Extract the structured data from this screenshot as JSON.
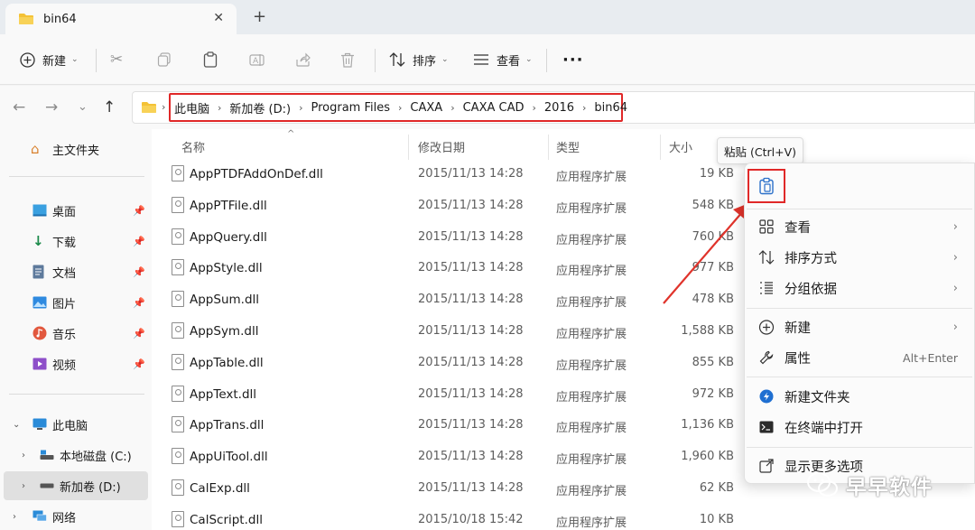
{
  "tab": {
    "title": "bin64",
    "close": "✕",
    "new_tab": "+"
  },
  "toolbar": {
    "new_label": "新建",
    "sort_label": "排序",
    "view_label": "查看",
    "more": "···"
  },
  "address": {
    "crumbs": [
      "此电脑",
      "新加卷 (D:)",
      "Program Files",
      "CAXA",
      "CAXA CAD",
      "2016",
      "bin64"
    ]
  },
  "sidebar": {
    "home": "主文件夹",
    "items": [
      {
        "label": "桌面",
        "icon": "desktop-icon"
      },
      {
        "label": "下载",
        "icon": "download-icon"
      },
      {
        "label": "文档",
        "icon": "document-icon"
      },
      {
        "label": "图片",
        "icon": "picture-icon"
      },
      {
        "label": "音乐",
        "icon": "music-icon"
      },
      {
        "label": "视频",
        "icon": "video-icon"
      }
    ],
    "this_pc": "此电脑",
    "drive_c": "本地磁盘 (C:)",
    "drive_d": "新加卷 (D:)",
    "network": "网络"
  },
  "columns": {
    "name": "名称",
    "date": "修改日期",
    "type": "类型",
    "size": "大小"
  },
  "files": [
    {
      "name": "AppPTDFAddOnDef.dll",
      "date": "2015/11/13 14:28",
      "type": "应用程序扩展",
      "size": "19 KB"
    },
    {
      "name": "AppPTFile.dll",
      "date": "2015/11/13 14:28",
      "type": "应用程序扩展",
      "size": "548 KB"
    },
    {
      "name": "AppQuery.dll",
      "date": "2015/11/13 14:28",
      "type": "应用程序扩展",
      "size": "760 KB"
    },
    {
      "name": "AppStyle.dll",
      "date": "2015/11/13 14:28",
      "type": "应用程序扩展",
      "size": "977 KB"
    },
    {
      "name": "AppSum.dll",
      "date": "2015/11/13 14:28",
      "type": "应用程序扩展",
      "size": "478 KB"
    },
    {
      "name": "AppSym.dll",
      "date": "2015/11/13 14:28",
      "type": "应用程序扩展",
      "size": "1,588 KB"
    },
    {
      "name": "AppTable.dll",
      "date": "2015/11/13 14:28",
      "type": "应用程序扩展",
      "size": "855 KB"
    },
    {
      "name": "AppText.dll",
      "date": "2015/11/13 14:28",
      "type": "应用程序扩展",
      "size": "972 KB"
    },
    {
      "name": "AppTrans.dll",
      "date": "2015/11/13 14:28",
      "type": "应用程序扩展",
      "size": "1,136 KB"
    },
    {
      "name": "AppUiTool.dll",
      "date": "2015/11/13 14:28",
      "type": "应用程序扩展",
      "size": "1,960 KB"
    },
    {
      "name": "CalExp.dll",
      "date": "2015/11/13 14:28",
      "type": "应用程序扩展",
      "size": "62 KB"
    },
    {
      "name": "CalScript.dll",
      "date": "2015/10/18 15:42",
      "type": "应用程序扩展",
      "size": "10 KB"
    }
  ],
  "context_menu": {
    "tooltip": "粘贴 (Ctrl+V)",
    "view": "查看",
    "sort_by": "排序方式",
    "group_by": "分组依据",
    "new": "新建",
    "properties": "属性",
    "properties_shortcut": "Alt+Enter",
    "new_folder": "新建文件夹",
    "open_terminal": "在终端中打开",
    "show_more": "显示更多选项"
  },
  "watermark": "早早软件",
  "colors": {
    "highlight_red": "#e02828",
    "folder_yellow": "#f4c236",
    "accent_blue": "#1f6fd1"
  }
}
